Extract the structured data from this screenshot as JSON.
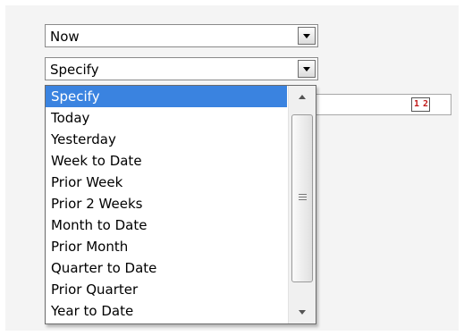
{
  "time_select": {
    "value": "Now"
  },
  "range_select": {
    "value": "Specify"
  },
  "date_picker": {
    "icon": "calendar-icon",
    "label": "1 2"
  },
  "range_options": [
    "Specify",
    "Today",
    "Yesterday",
    "Week to Date",
    "Prior Week",
    "Prior 2 Weeks",
    "Month to Date",
    "Prior Month",
    "Quarter to Date",
    "Prior Quarter",
    "Year to Date"
  ],
  "colors": {
    "selection": "#3a83e0",
    "panel": "#f4f4f4"
  }
}
